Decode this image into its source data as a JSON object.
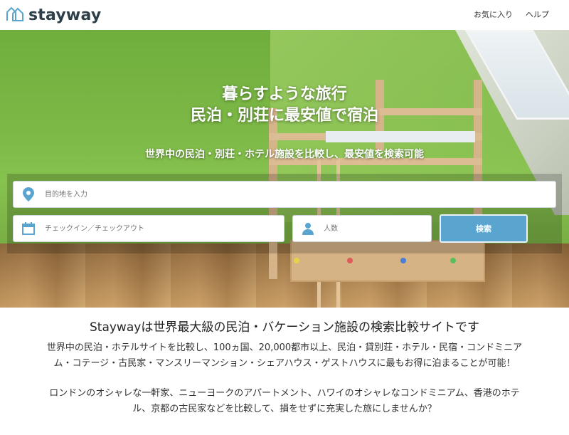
{
  "header": {
    "brand": "stayway",
    "nav": [
      "お気に入り",
      "ヘルプ"
    ]
  },
  "hero": {
    "title_line1": "暮らすような旅行",
    "title_line2": "民泊・別荘に最安値で宿泊",
    "subtitle": "世界中の民泊・別荘・ホテル施設を比較し、最安値を検索可能"
  },
  "search": {
    "destination_placeholder": "目的地を入力",
    "dates_placeholder": "チェックイン／チェックアウト",
    "guests_placeholder": "人数",
    "button_label": "検索"
  },
  "intro": {
    "heading": "Staywayは世界最大級の民泊・バケーション施設の検索比較サイトです",
    "paragraph1": "世界中の民泊・ホテルサイトを比較し、100ヵ国、20,000都市以上、民泊・貸別荘・ホテル・民宿・コンドミニアム・コテージ・古民家・マンスリーマンション・シェアハウス・ゲストハウスに最もお得に泊まることが可能！",
    "paragraph2": "ロンドンのオシャレな一軒家、ニューヨークのアパートメント、ハワイのオシャレなコンドミニアム、香港のホテル、京都の古民家などを比較して、損をせずに充実した旅にしませんか？"
  },
  "colors": {
    "accent": "#5aa5cf",
    "brand_text": "#2d3e48",
    "logo_icon": "#5aa5cf"
  }
}
